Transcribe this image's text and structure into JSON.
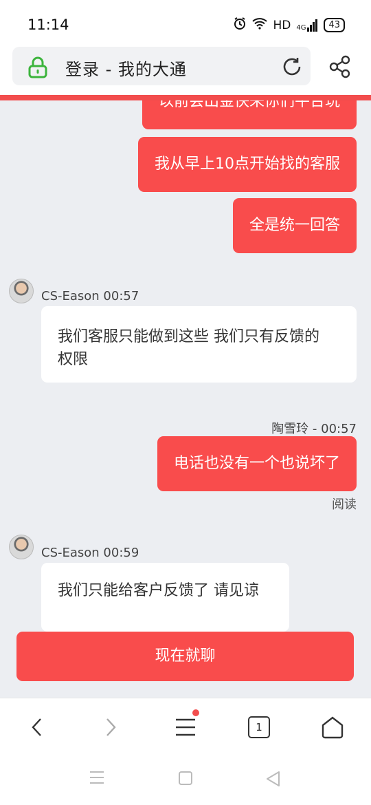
{
  "status_bar": {
    "time": "11:14",
    "network": "HD",
    "signal": "4G",
    "battery": "43"
  },
  "address_bar": {
    "title": "登录 - 我的大通"
  },
  "messages": [
    {
      "type": "outgoing",
      "text": "以前会出金快来你们平台玩"
    },
    {
      "type": "outgoing",
      "text": "我从早上10点开始找的客服"
    },
    {
      "type": "outgoing",
      "text": "全是统一回答"
    },
    {
      "type": "incoming",
      "sender": "CS-Eason 00:57",
      "lines": [
        "我们客服只能做到这些 我们只有反馈的",
        "权限"
      ]
    },
    {
      "type": "outgoing",
      "sender": "陶雪玲 - 00:57",
      "text": "电话也没有一个也说坏了",
      "status": "阅读"
    },
    {
      "type": "incoming",
      "sender": "CS-Eason 00:59",
      "lines": [
        "我们只能给客户反馈了 请见谅"
      ]
    }
  ],
  "chat_button": {
    "label": "现在就聊"
  },
  "browser_nav": {
    "tabs_count": "1"
  },
  "colors": {
    "accent": "#f94c4c",
    "chat_bg": "#eceef2",
    "lock": "#3cb43c"
  }
}
